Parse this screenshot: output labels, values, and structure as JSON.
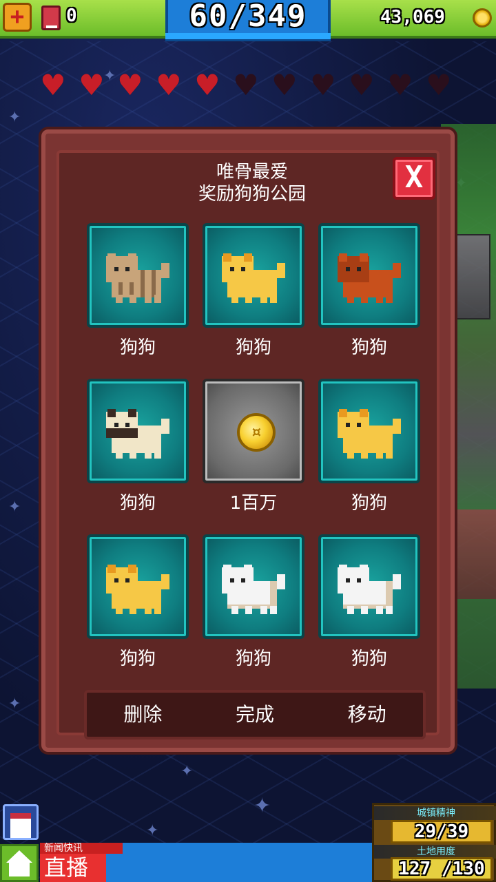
{
  "topbar": {
    "add_label": "+",
    "gems": "0",
    "population": "60/349",
    "coins": "43,069"
  },
  "hearts": {
    "filled": 5,
    "total": 11
  },
  "dialog": {
    "title_line1": "唯骨最爱",
    "title_line2": "奖励狗狗公园",
    "close_label": "X",
    "items": [
      {
        "label": "狗狗",
        "kind": "dog",
        "breed": "tabby"
      },
      {
        "label": "狗狗",
        "kind": "dog",
        "breed": "gold"
      },
      {
        "label": "狗狗",
        "kind": "dog",
        "breed": "red"
      },
      {
        "label": "狗狗",
        "kind": "dog",
        "breed": "pug"
      },
      {
        "label": "1百万",
        "kind": "coin",
        "breed": ""
      },
      {
        "label": "狗狗",
        "kind": "dog",
        "breed": "gold"
      },
      {
        "label": "狗狗",
        "kind": "dog",
        "breed": "gold"
      },
      {
        "label": "狗狗",
        "kind": "dog",
        "breed": "white"
      },
      {
        "label": "狗狗",
        "kind": "dog",
        "breed": "white"
      }
    ],
    "actions": {
      "delete": "删除",
      "done": "完成",
      "move": "移动"
    }
  },
  "bottombar": {
    "news_tag": "新闻快讯",
    "news_live": "直播",
    "stat1_label": "城镇精神",
    "stat1_value": "29/39",
    "stat2_label": "土地用度",
    "stat2_value": "127 /130"
  },
  "colors": {
    "topbar_green": "#6cbd2a",
    "topbar_blue": "#1d7ed8",
    "dialog_red": "#7b3432",
    "tile_teal": "#0f7d80",
    "heart_red": "#c81e28"
  },
  "icons": [
    "plus-icon",
    "book-icon",
    "coin-icon",
    "heart-icon",
    "close-icon",
    "calendar-icon",
    "home-icon"
  ]
}
